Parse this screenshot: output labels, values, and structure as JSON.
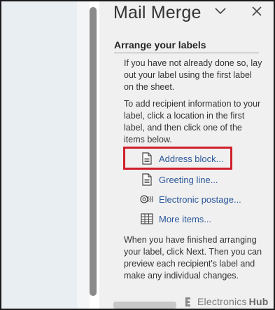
{
  "pane": {
    "title": "Mail Merge",
    "section_title": "Arrange your labels",
    "para1": "If you have not already done so, lay out your label using the first label on the sheet.",
    "para2": "To add recipient information to your label, click a location in the first label, and then click one of the items below.",
    "items": [
      {
        "label": "Address block...",
        "icon": "document-icon"
      },
      {
        "label": "Greeting line...",
        "icon": "document-icon"
      },
      {
        "label": "Electronic postage...",
        "icon": "postage-icon"
      },
      {
        "label": "More items...",
        "icon": "table-icon"
      }
    ],
    "para3": "When you have finished arranging your label, click Next. Then you can preview each recipient's label and make any individual changes."
  },
  "watermark": {
    "text_a": "Electronics",
    "text_b": "Hub"
  },
  "colors": {
    "link": "#2b579a",
    "highlight": "#d0202b",
    "pane_bg": "#f0f0f0"
  }
}
